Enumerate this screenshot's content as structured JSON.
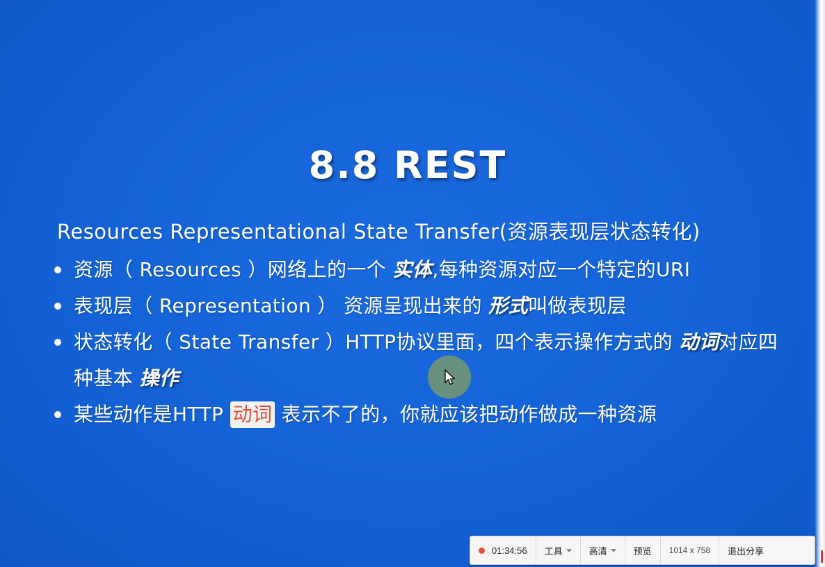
{
  "slide": {
    "title": "8.8 REST",
    "subtitle": "Resources Representational State Transfer(资源表现层状态转化)",
    "bullets": [
      {
        "pre": "资源（ Resources ）网络上的一个 ",
        "emph": "实体",
        "post": ",每种资源对应一个特定的URI"
      },
      {
        "pre": "表现层（ Representation ） 资源呈现出来的 ",
        "emph": "形式",
        "post": "叫做表现层"
      },
      {
        "pre": "状态转化（ State Transfer ）HTTP协议里面，四个表示操作方式的 ",
        "emph": "动词",
        "mid": "对应四种基本 ",
        "emph2": "操作"
      },
      {
        "pre": "某些动作是HTTP ",
        "highlight": "动词",
        "post": " 表示不了的，你就应该把动作做成一种资源"
      }
    ]
  },
  "toolbar": {
    "timer": "01:34:56",
    "tools_label": "工具",
    "quality_label": "高清",
    "preview_label": "预览",
    "resolution": "1014 x 758",
    "exit_label": "退出分享"
  },
  "colors": {
    "background": "#1560d4",
    "highlight_text": "#e04a3a",
    "record_dot": "#e8503c"
  },
  "icons": {
    "cursor": "arrow-cursor-icon",
    "record": "record-dot-icon",
    "dropdown": "chevron-down-icon"
  }
}
